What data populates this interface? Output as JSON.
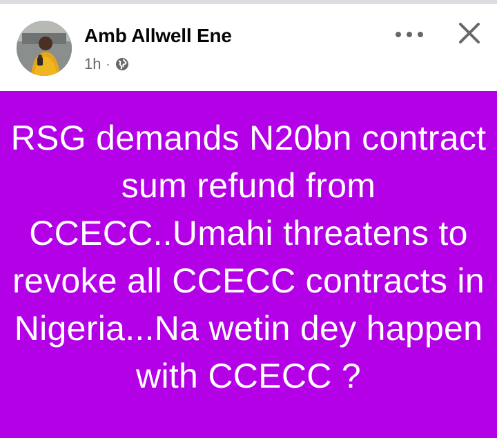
{
  "post": {
    "author": {
      "name": "Amb Allwell Ene",
      "avatar_icon": "profile-photo-avatar"
    },
    "meta": {
      "time": "1h",
      "separator": "·",
      "audience_icon": "globe-icon"
    },
    "actions": {
      "more_icon": "more-horizontal-icon",
      "close_icon": "close-icon"
    },
    "banner": {
      "background_color": "#b400e6",
      "text_color": "#ffffff",
      "text": "RSG demands N20bn contract sum refund from CCECC..Umahi threatens to revoke all CCECC contracts in Nigeria...Na wetin dey happen with CCECC ?"
    }
  }
}
